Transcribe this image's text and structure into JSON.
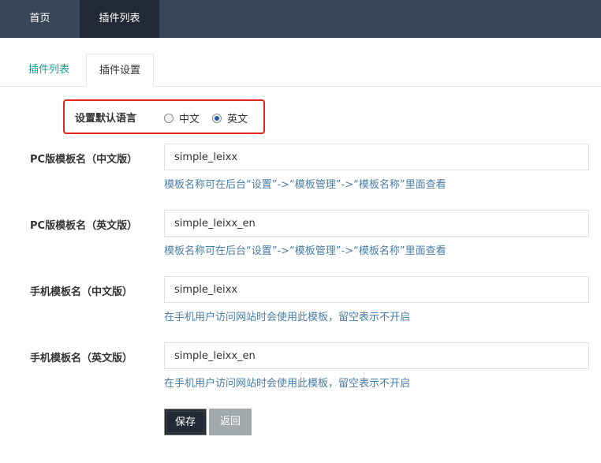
{
  "topnav": {
    "home": "首页",
    "plugins": "插件列表"
  },
  "tabs": {
    "list": "插件列表",
    "settings": "插件设置"
  },
  "language": {
    "label": "设置默认语言",
    "option_zh": "中文",
    "option_en": "英文",
    "selected": "英文"
  },
  "form": {
    "pc_zh": {
      "label": "PC版模板名（中文版）",
      "value": "simple_leixx",
      "help": "模板名称可在后台“设置”->“模板管理”->“模板名称”里面查看"
    },
    "pc_en": {
      "label": "PC版模板名（英文版）",
      "value": "simple_leixx_en",
      "help": "模板名称可在后台“设置”->“模板管理”->“模板名称”里面查看"
    },
    "mobile_zh": {
      "label": "手机模板名（中文版）",
      "value": "simple_leixx",
      "help": "在手机用户访问网站时会使用此模板，留空表示不开启"
    },
    "mobile_en": {
      "label": "手机模板名（英文版）",
      "value": "simple_leixx_en",
      "help": "在手机用户访问网站时会使用此模板，留空表示不开启"
    }
  },
  "buttons": {
    "save": "保存",
    "back": "返回"
  },
  "colors": {
    "topbar": "#394656",
    "active_nav": "#222a35",
    "tab_active_text": "#1aa094",
    "highlight_border": "#e3251e",
    "help_text": "#4a7ea8",
    "back_button": "#a2a9ad"
  }
}
